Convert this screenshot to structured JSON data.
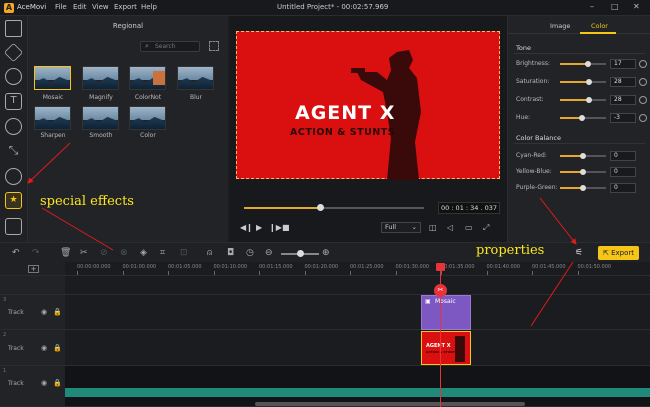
{
  "app": {
    "name": "AceMovi",
    "window_title": "Untitled Project* - 00:02:57.969"
  },
  "menu": [
    "File",
    "Edit",
    "View",
    "Export",
    "Help"
  ],
  "effects": {
    "header": "Regional",
    "search_placeholder": "Search",
    "items": [
      "Mosaic",
      "Magnify",
      "ColorNot",
      "Blur",
      "Sharpen",
      "Smooth",
      "Color"
    ]
  },
  "preview": {
    "title_line1": "AGENT X",
    "title_line2": "ACTION & STUNTS",
    "timecode": "00 : 01 : 34 . 037",
    "quality": "Full",
    "progress": 0.42
  },
  "properties": {
    "tabs": [
      "Image",
      "Color"
    ],
    "active_tab": "Color",
    "tone_header": "Tone",
    "tone": [
      {
        "label": "Brightness:",
        "value": "17",
        "level": 0.6
      },
      {
        "label": "Saturation:",
        "value": "28",
        "level": 0.62
      },
      {
        "label": "Contrast:",
        "value": "28",
        "level": 0.62
      },
      {
        "label": "Hue:",
        "value": "-3",
        "level": 0.48
      }
    ],
    "balance_header": "Color Balance",
    "balance": [
      {
        "label": "Cyan-Red:",
        "value": "0",
        "level": 0.5
      },
      {
        "label": "Yellow-Blue:",
        "value": "0",
        "level": 0.5
      },
      {
        "label": "Purple-Green:",
        "value": "0",
        "level": 0.5
      }
    ]
  },
  "toolbar": {
    "export_label": "Export"
  },
  "ruler": [
    "00:00:00.000",
    "00:01:00.000",
    "00:01:05.000",
    "00:01:10.000",
    "00:01:15.000",
    "00:01:20.000",
    "00:01:25.000",
    "00:01:30.000",
    "00:01:35.000",
    "00:01:40.000",
    "00:01:45.000",
    "00:01:50.000"
  ],
  "tracks": [
    {
      "number": "3",
      "name": "Track"
    },
    {
      "number": "2",
      "name": "Track"
    },
    {
      "number": "1",
      "name": "Track"
    }
  ],
  "clips": {
    "mosaic_label": "Mosaic",
    "video_title1": "AGENT X",
    "video_title2": "ACTION & STUNTS"
  },
  "annotations": {
    "special_effects": "special effects",
    "properties": "properties"
  },
  "colors": {
    "accent": "#f5c518",
    "preview_red": "#d9100f",
    "mosaic_clip": "#7e58c2",
    "playhead": "#e8333a",
    "audio": "#1f8a79"
  }
}
